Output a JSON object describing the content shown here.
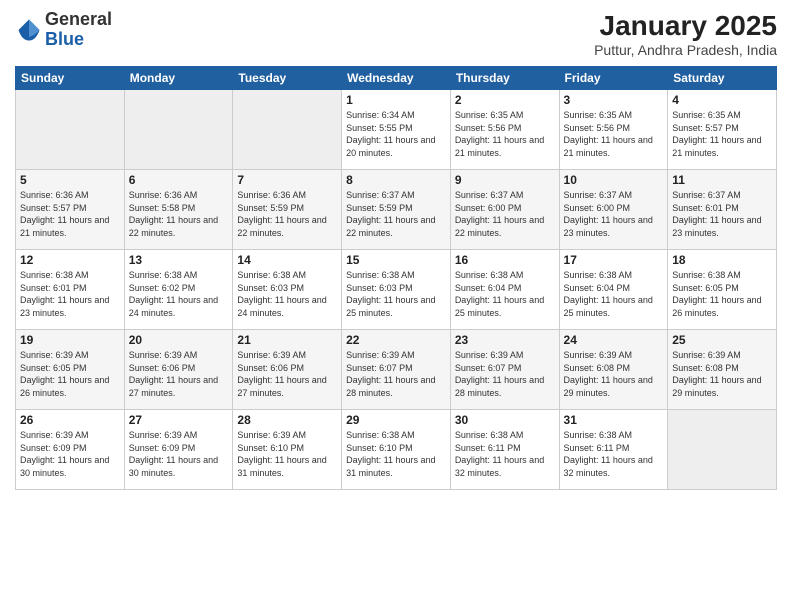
{
  "logo": {
    "general": "General",
    "blue": "Blue"
  },
  "title": "January 2025",
  "subtitle": "Puttur, Andhra Pradesh, India",
  "header": {
    "days": [
      "Sunday",
      "Monday",
      "Tuesday",
      "Wednesday",
      "Thursday",
      "Friday",
      "Saturday"
    ]
  },
  "weeks": [
    [
      {
        "day": "",
        "info": ""
      },
      {
        "day": "",
        "info": ""
      },
      {
        "day": "",
        "info": ""
      },
      {
        "day": "1",
        "info": "Sunrise: 6:34 AM\nSunset: 5:55 PM\nDaylight: 11 hours\nand 20 minutes."
      },
      {
        "day": "2",
        "info": "Sunrise: 6:35 AM\nSunset: 5:56 PM\nDaylight: 11 hours\nand 21 minutes."
      },
      {
        "day": "3",
        "info": "Sunrise: 6:35 AM\nSunset: 5:56 PM\nDaylight: 11 hours\nand 21 minutes."
      },
      {
        "day": "4",
        "info": "Sunrise: 6:35 AM\nSunset: 5:57 PM\nDaylight: 11 hours\nand 21 minutes."
      }
    ],
    [
      {
        "day": "5",
        "info": "Sunrise: 6:36 AM\nSunset: 5:57 PM\nDaylight: 11 hours\nand 21 minutes."
      },
      {
        "day": "6",
        "info": "Sunrise: 6:36 AM\nSunset: 5:58 PM\nDaylight: 11 hours\nand 22 minutes."
      },
      {
        "day": "7",
        "info": "Sunrise: 6:36 AM\nSunset: 5:59 PM\nDaylight: 11 hours\nand 22 minutes."
      },
      {
        "day": "8",
        "info": "Sunrise: 6:37 AM\nSunset: 5:59 PM\nDaylight: 11 hours\nand 22 minutes."
      },
      {
        "day": "9",
        "info": "Sunrise: 6:37 AM\nSunset: 6:00 PM\nDaylight: 11 hours\nand 22 minutes."
      },
      {
        "day": "10",
        "info": "Sunrise: 6:37 AM\nSunset: 6:00 PM\nDaylight: 11 hours\nand 23 minutes."
      },
      {
        "day": "11",
        "info": "Sunrise: 6:37 AM\nSunset: 6:01 PM\nDaylight: 11 hours\nand 23 minutes."
      }
    ],
    [
      {
        "day": "12",
        "info": "Sunrise: 6:38 AM\nSunset: 6:01 PM\nDaylight: 11 hours\nand 23 minutes."
      },
      {
        "day": "13",
        "info": "Sunrise: 6:38 AM\nSunset: 6:02 PM\nDaylight: 11 hours\nand 24 minutes."
      },
      {
        "day": "14",
        "info": "Sunrise: 6:38 AM\nSunset: 6:03 PM\nDaylight: 11 hours\nand 24 minutes."
      },
      {
        "day": "15",
        "info": "Sunrise: 6:38 AM\nSunset: 6:03 PM\nDaylight: 11 hours\nand 25 minutes."
      },
      {
        "day": "16",
        "info": "Sunrise: 6:38 AM\nSunset: 6:04 PM\nDaylight: 11 hours\nand 25 minutes."
      },
      {
        "day": "17",
        "info": "Sunrise: 6:38 AM\nSunset: 6:04 PM\nDaylight: 11 hours\nand 25 minutes."
      },
      {
        "day": "18",
        "info": "Sunrise: 6:38 AM\nSunset: 6:05 PM\nDaylight: 11 hours\nand 26 minutes."
      }
    ],
    [
      {
        "day": "19",
        "info": "Sunrise: 6:39 AM\nSunset: 6:05 PM\nDaylight: 11 hours\nand 26 minutes."
      },
      {
        "day": "20",
        "info": "Sunrise: 6:39 AM\nSunset: 6:06 PM\nDaylight: 11 hours\nand 27 minutes."
      },
      {
        "day": "21",
        "info": "Sunrise: 6:39 AM\nSunset: 6:06 PM\nDaylight: 11 hours\nand 27 minutes."
      },
      {
        "day": "22",
        "info": "Sunrise: 6:39 AM\nSunset: 6:07 PM\nDaylight: 11 hours\nand 28 minutes."
      },
      {
        "day": "23",
        "info": "Sunrise: 6:39 AM\nSunset: 6:07 PM\nDaylight: 11 hours\nand 28 minutes."
      },
      {
        "day": "24",
        "info": "Sunrise: 6:39 AM\nSunset: 6:08 PM\nDaylight: 11 hours\nand 29 minutes."
      },
      {
        "day": "25",
        "info": "Sunrise: 6:39 AM\nSunset: 6:08 PM\nDaylight: 11 hours\nand 29 minutes."
      }
    ],
    [
      {
        "day": "26",
        "info": "Sunrise: 6:39 AM\nSunset: 6:09 PM\nDaylight: 11 hours\nand 30 minutes."
      },
      {
        "day": "27",
        "info": "Sunrise: 6:39 AM\nSunset: 6:09 PM\nDaylight: 11 hours\nand 30 minutes."
      },
      {
        "day": "28",
        "info": "Sunrise: 6:39 AM\nSunset: 6:10 PM\nDaylight: 11 hours\nand 31 minutes."
      },
      {
        "day": "29",
        "info": "Sunrise: 6:38 AM\nSunset: 6:10 PM\nDaylight: 11 hours\nand 31 minutes."
      },
      {
        "day": "30",
        "info": "Sunrise: 6:38 AM\nSunset: 6:11 PM\nDaylight: 11 hours\nand 32 minutes."
      },
      {
        "day": "31",
        "info": "Sunrise: 6:38 AM\nSunset: 6:11 PM\nDaylight: 11 hours\nand 32 minutes."
      },
      {
        "day": "",
        "info": ""
      }
    ]
  ]
}
